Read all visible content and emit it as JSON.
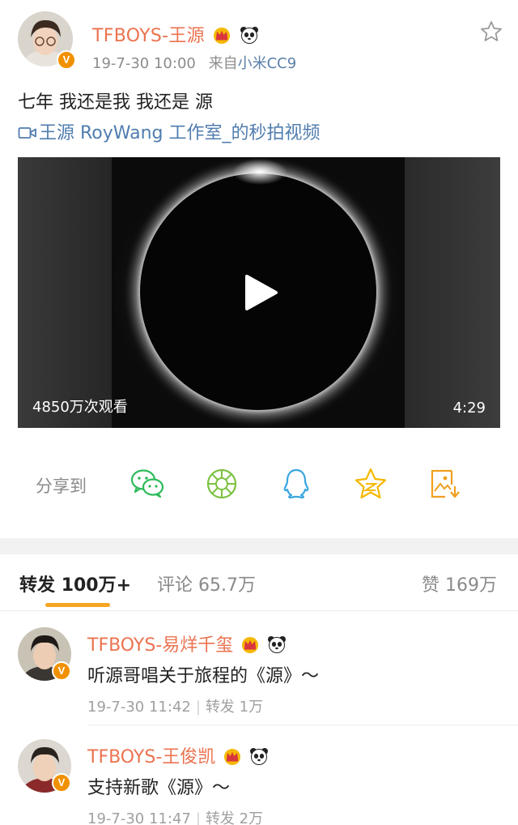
{
  "post": {
    "author": "TFBOYS-王源",
    "date": "19-7-30 10:00",
    "source_prefix": "来自",
    "source": "小米CC9",
    "text": "七年 我还是我 我还是 源",
    "link_text": "王源 RoyWang 工作室_的秒拍视频",
    "badge": "V"
  },
  "video": {
    "views": "4850万次观看",
    "duration": "4:29"
  },
  "share": {
    "label": "分享到",
    "targets": [
      "wechat-icon",
      "moments-icon",
      "qq-icon",
      "qzone-icon",
      "save-image-icon"
    ]
  },
  "tabs": {
    "repost_label": "转发",
    "repost_count": "100万+",
    "comment_label": "评论",
    "comment_count": "65.7万",
    "like_label": "赞",
    "like_count": "169万"
  },
  "reposts": [
    {
      "name": "TFBOYS-易烊千玺",
      "text": "听源哥唱关于旅程的《源》～",
      "date": "19-7-30 11:42",
      "repost_label": "转发",
      "repost_count": "1万"
    },
    {
      "name": "TFBOYS-王俊凯",
      "text": "支持新歌《源》～",
      "date": "19-7-30 11:47",
      "repost_label": "转发",
      "repost_count": "2万"
    }
  ],
  "colors": {
    "name": "#eb7350",
    "link": "#507daf",
    "accent": "#f5a623",
    "badge": "#f29100"
  }
}
